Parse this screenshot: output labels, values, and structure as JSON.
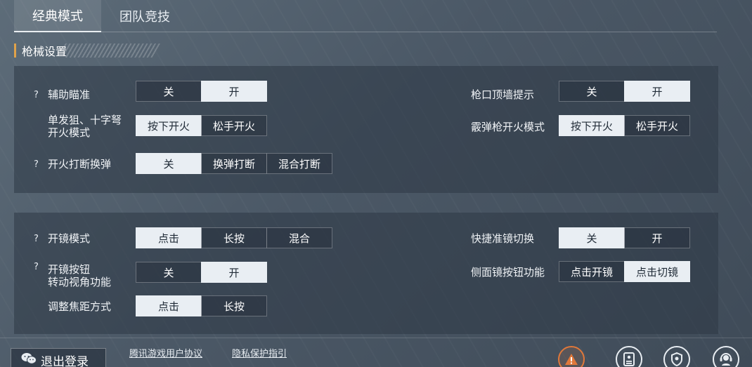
{
  "tabs": [
    {
      "label": "经典模式",
      "active": true
    },
    {
      "label": "团队竞技",
      "active": false
    }
  ],
  "section": {
    "title": "枪械设置"
  },
  "panel1": {
    "aim_assist": {
      "help": "?",
      "label": "辅助瞄准",
      "options": [
        "关",
        "开"
      ],
      "selected": 1
    },
    "single_shot": {
      "label_line1": "单发狙、十字弩",
      "label_line2": "开火模式",
      "options": [
        "按下开火",
        "松手开火"
      ],
      "selected": 0
    },
    "fire_interrupt": {
      "help": "?",
      "label": "开火打断换弹",
      "options": [
        "关",
        "换弹打断",
        "混合打断"
      ],
      "selected": 0
    },
    "muzzle_wall": {
      "label": "枪口顶墙提示",
      "options": [
        "关",
        "开"
      ],
      "selected": 1
    },
    "shotgun_fire": {
      "label": "霰弹枪开火模式",
      "options": [
        "按下开火",
        "松手开火"
      ],
      "selected": 0
    }
  },
  "panel2": {
    "scope_mode": {
      "help": "?",
      "label": "开镜模式",
      "options": [
        "点击",
        "长按",
        "混合"
      ],
      "selected": 0
    },
    "scope_rotate": {
      "help": "?",
      "label_line1": "开镜按钮",
      "label_line2": "转动视角功能",
      "options": [
        "关",
        "开"
      ],
      "selected": 1
    },
    "focal_adjust": {
      "label": "调整焦距方式",
      "options": [
        "点击",
        "长按"
      ],
      "selected": 0
    },
    "quick_scope_switch": {
      "label": "快捷准镜切换",
      "options": [
        "关",
        "开"
      ],
      "selected": 0
    },
    "side_scope": {
      "label": "侧面镜按钮功能",
      "options": [
        "点击开镜",
        "点击切镜"
      ],
      "selected": 1
    }
  },
  "footer": {
    "logout": "退出登录",
    "user_agreement": "腾讯游戏用户协议",
    "privacy": "隐私保护指引"
  },
  "colors": {
    "accent": "#e0a24a",
    "selected_bg": "#e9eef3",
    "warning": "#e0783a"
  }
}
